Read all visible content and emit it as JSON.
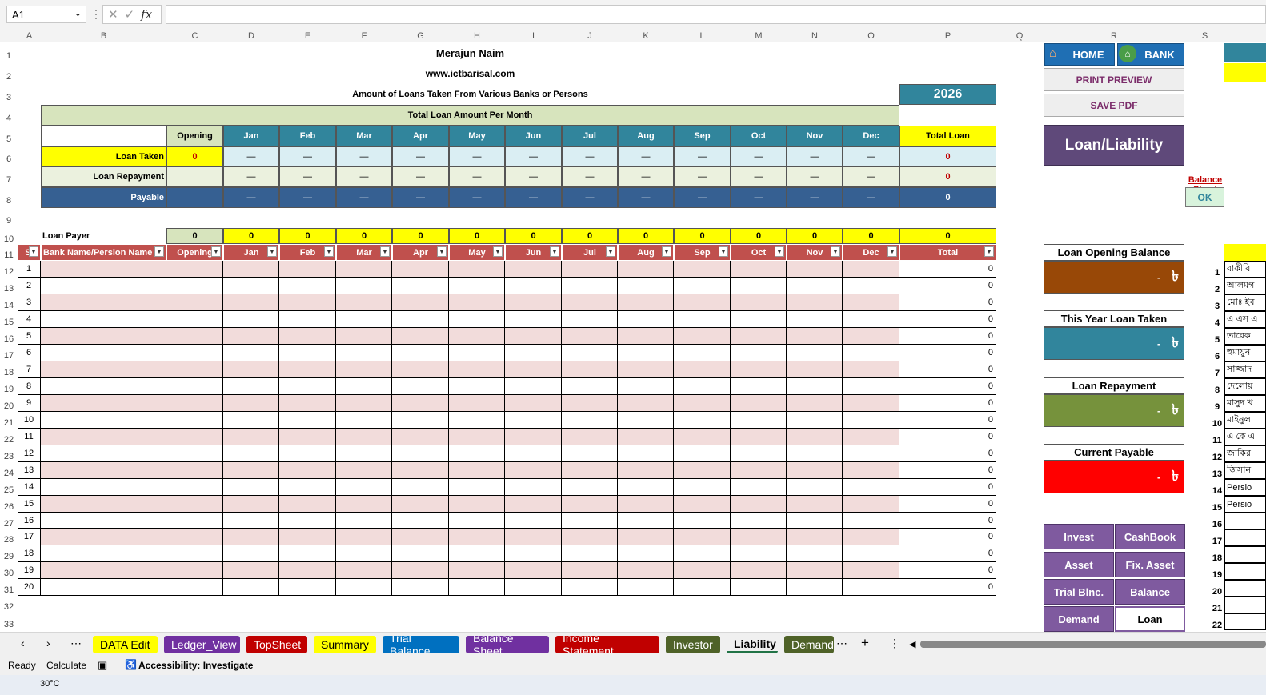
{
  "formula_bar": {
    "name_box": "A1",
    "value": ""
  },
  "columns": [
    "A",
    "B",
    "C",
    "D",
    "E",
    "F",
    "G",
    "H",
    "I",
    "J",
    "K",
    "L",
    "M",
    "N",
    "O",
    "P",
    "Q",
    "R",
    "S"
  ],
  "header": {
    "company": "Merajun Naim",
    "website": "www.ictbarisal.com",
    "subtitle": "Amount of Loans Taken From Various Banks or Persons",
    "year": "2026",
    "total_title": "Total Loan Amount Per Month"
  },
  "summary": {
    "col_opening": "Opening",
    "months": [
      "Jan",
      "Feb",
      "Mar",
      "Apr",
      "May",
      "Jun",
      "Jul",
      "Aug",
      "Sep",
      "Oct",
      "Nov",
      "Dec"
    ],
    "col_total": "Total Loan",
    "rows": [
      {
        "label": "Loan Taken",
        "opening": "0",
        "dash": "—",
        "total": "0"
      },
      {
        "label": "Loan Repayment",
        "opening": "",
        "dash": "—",
        "total": "0"
      },
      {
        "label": "Payable",
        "opening": "",
        "dash": "—",
        "total": "0"
      }
    ]
  },
  "payer": {
    "label": "Loan Payer",
    "opening": "0",
    "monthly": "0",
    "total": "0"
  },
  "table": {
    "headers": [
      "Sl",
      "Bank Name/Persion Name",
      "Opening",
      "Jan",
      "Feb",
      "Mar",
      "Apr",
      "May",
      "Jun",
      "Jul",
      "Aug",
      "Sep",
      "Oct",
      "Nov",
      "Dec",
      "Total"
    ],
    "row_total": "0",
    "row_count": 20
  },
  "buttons": {
    "home": "HOME",
    "bank": "BANK",
    "print_preview": "PRINT PREVIEW",
    "save_pdf": "SAVE PDF",
    "title": "Loan/Liability",
    "balance_sheet_link": "Balance Sheet",
    "ok": "OK"
  },
  "cards": [
    {
      "title": "Loan Opening Balance",
      "value": "-",
      "currency": "৳",
      "color": "#984807"
    },
    {
      "title": "This Year Loan Taken",
      "value": "-",
      "currency": "৳",
      "color": "#31859c"
    },
    {
      "title": "Loan Repayment",
      "value": "-",
      "currency": "৳",
      "color": "#76923c"
    },
    {
      "title": "Current Payable",
      "value": "-",
      "currency": "৳",
      "color": "#ff0000"
    }
  ],
  "nav_buttons": [
    "Invest",
    "CashBook",
    "Asset",
    "Fix. Asset",
    "Trial Blnc.",
    "Balance",
    "Demand",
    "Loan"
  ],
  "side_list": [
    "বাকীবি",
    "আলমগ",
    "মোঃ ইব",
    "এ এস এ",
    "তারেক",
    "হুমায়ুন",
    "সাজ্জাদ",
    "দেলোয়",
    "মাসুদ খ",
    "মাইনুল",
    "এ কে এ",
    "জাকির",
    "জিসান",
    "Persio",
    "Persio"
  ],
  "sheet_tabs": [
    "DATA Edit",
    "Ledger_View",
    "TopSheet",
    "Summary",
    "Trial Balance",
    "Balance Sheet",
    "Income Statement",
    "Investor",
    "Liability",
    "Demand"
  ],
  "status": {
    "ready": "Ready",
    "calculate": "Calculate",
    "accessibility": "Accessibility: Investigate"
  },
  "weather": "30°C"
}
